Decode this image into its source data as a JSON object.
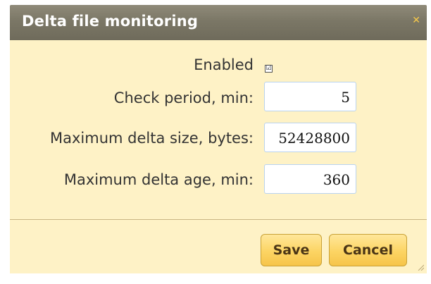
{
  "dialog": {
    "title": "Delta file monitoring",
    "close_icon": "close-icon"
  },
  "form": {
    "enabled": {
      "label": "Enabled",
      "checked": true,
      "check_glyph": "☑"
    },
    "check_period": {
      "label": "Check period, min:",
      "value": "5"
    },
    "max_delta_size": {
      "label": "Maximum delta size, bytes:",
      "value": "52428800"
    },
    "max_delta_age": {
      "label": "Maximum delta age, min:",
      "value": "360"
    }
  },
  "buttons": {
    "save": "Save",
    "cancel": "Cancel"
  },
  "colors": {
    "titlebar": "#7b7766",
    "body_background": "#fef2c6",
    "button": "#fcd463",
    "close_icon": "#f6c84a"
  }
}
